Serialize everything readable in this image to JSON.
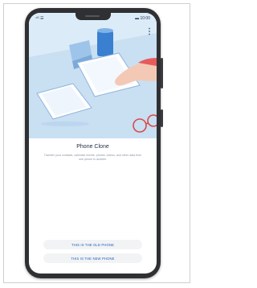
{
  "status_bar": {
    "left": "⁴ᴳ ☰",
    "right": "▬ 10:00"
  },
  "screen": {
    "title": "Phone Clone",
    "description": "Transfer your contacts, calendar events, photos, videos, and other data from one phone to another."
  },
  "buttons": {
    "old_phone": "THIS IS THE OLD PHONE",
    "new_phone": "THIS IS THE NEW PHONE"
  },
  "colors": {
    "accent": "#1f5fbf",
    "hero_bg": "#d6e8f7"
  },
  "icons": [
    "more-vertical-icon"
  ]
}
